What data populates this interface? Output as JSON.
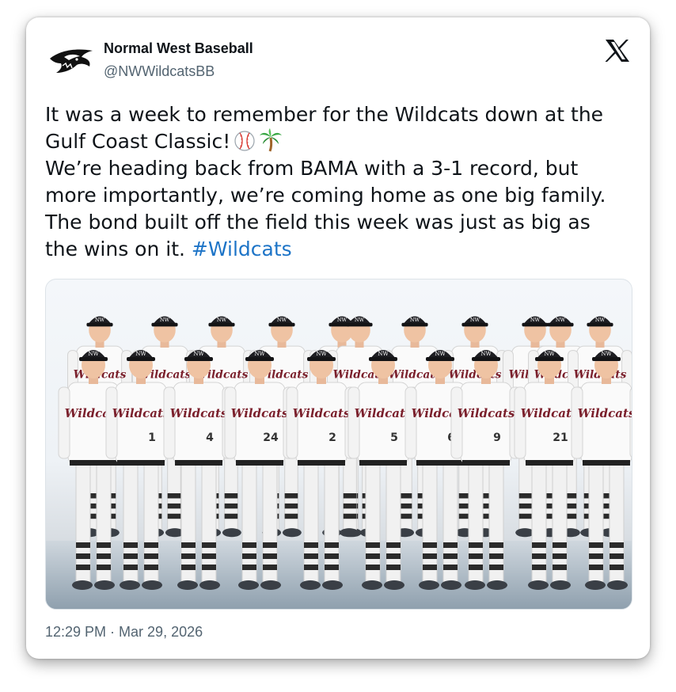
{
  "tweet": {
    "display_name": "Normal West Baseball",
    "handle": "@NWWildcatsBB",
    "lines": [
      "It was a week to remember for the Wildcats down at the",
      "Gulf Coast Classic!",
      "We’re heading back from BAMA with a 3-1 record, but",
      "more importantly, we’re coming home as one big family.",
      "The bond built off the field this week was just as big as",
      "the wins on it."
    ],
    "hashtag": "#Wildcats",
    "emojis": [
      "baseball-emoji",
      "palm-tree-emoji"
    ],
    "timestamp": "12:29 PM · Mar 29, 2026"
  },
  "photo": {
    "jersey_text": "Wildcats",
    "cap_text": "NW",
    "jersey_numbers": [
      "",
      "1",
      "4",
      "24",
      "2",
      "5",
      "6",
      "9",
      "21"
    ]
  },
  "colors": {
    "hashtag": "#1d74c7",
    "text": "#0f1419",
    "secondary": "#536471",
    "team_maroon": "#7a1f2b"
  }
}
